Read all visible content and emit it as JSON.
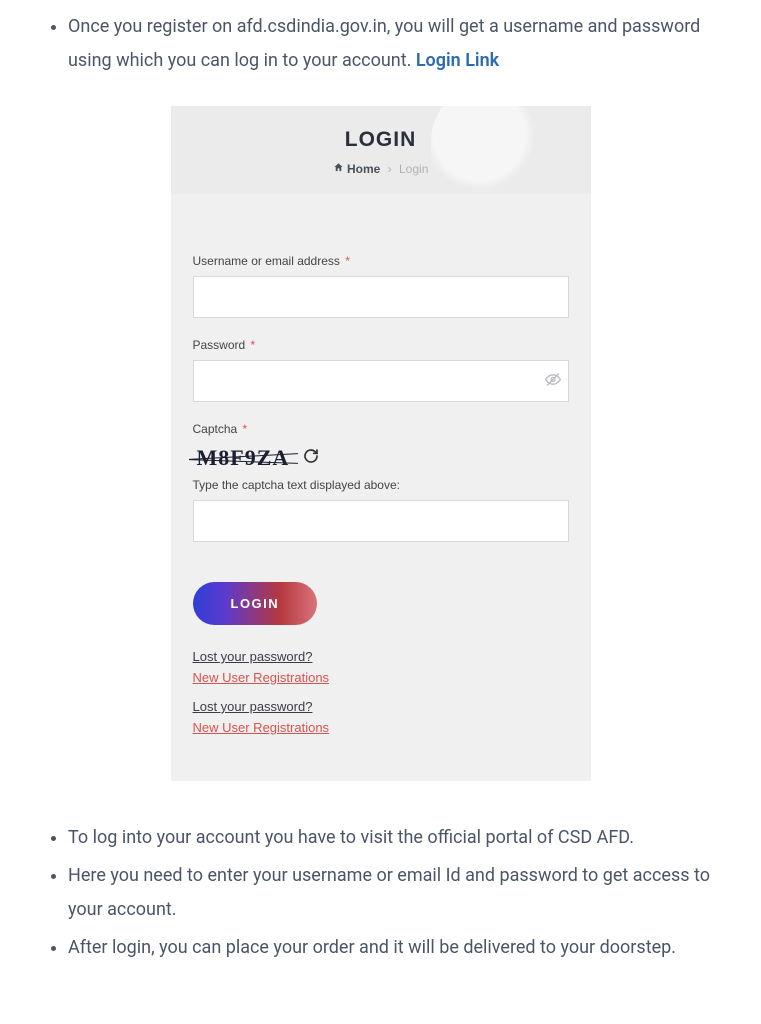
{
  "intro": {
    "bullet1_pre": "Once you register on afd.csdindia.gov.in, you will get a username and password using which you can log in to your account. ",
    "login_link": "Login Link"
  },
  "login": {
    "title": "LOGIN",
    "crumb_home": "Home",
    "crumb_sep": "›",
    "crumb_current": "Login",
    "username_label": "Username or email address",
    "asterisk": "*",
    "password_label": "Password",
    "captcha_label": "Captcha",
    "captcha_value": "M8F9ZA",
    "captcha_hint": "Type the captcha text displayed above:",
    "button": "LOGIN",
    "lost1": "Lost your password?",
    "reg1": "New User Registrations",
    "lost2": "Lost your password?",
    "reg2": "New User Registrations"
  },
  "outro": {
    "b1": "To log into your account you have to visit the official portal of CSD AFD.",
    "b2": "Here you need to enter your username or email Id and password to get access to your account.",
    "b3": "After login, you can place your order and it will be delivered to your doorstep."
  }
}
